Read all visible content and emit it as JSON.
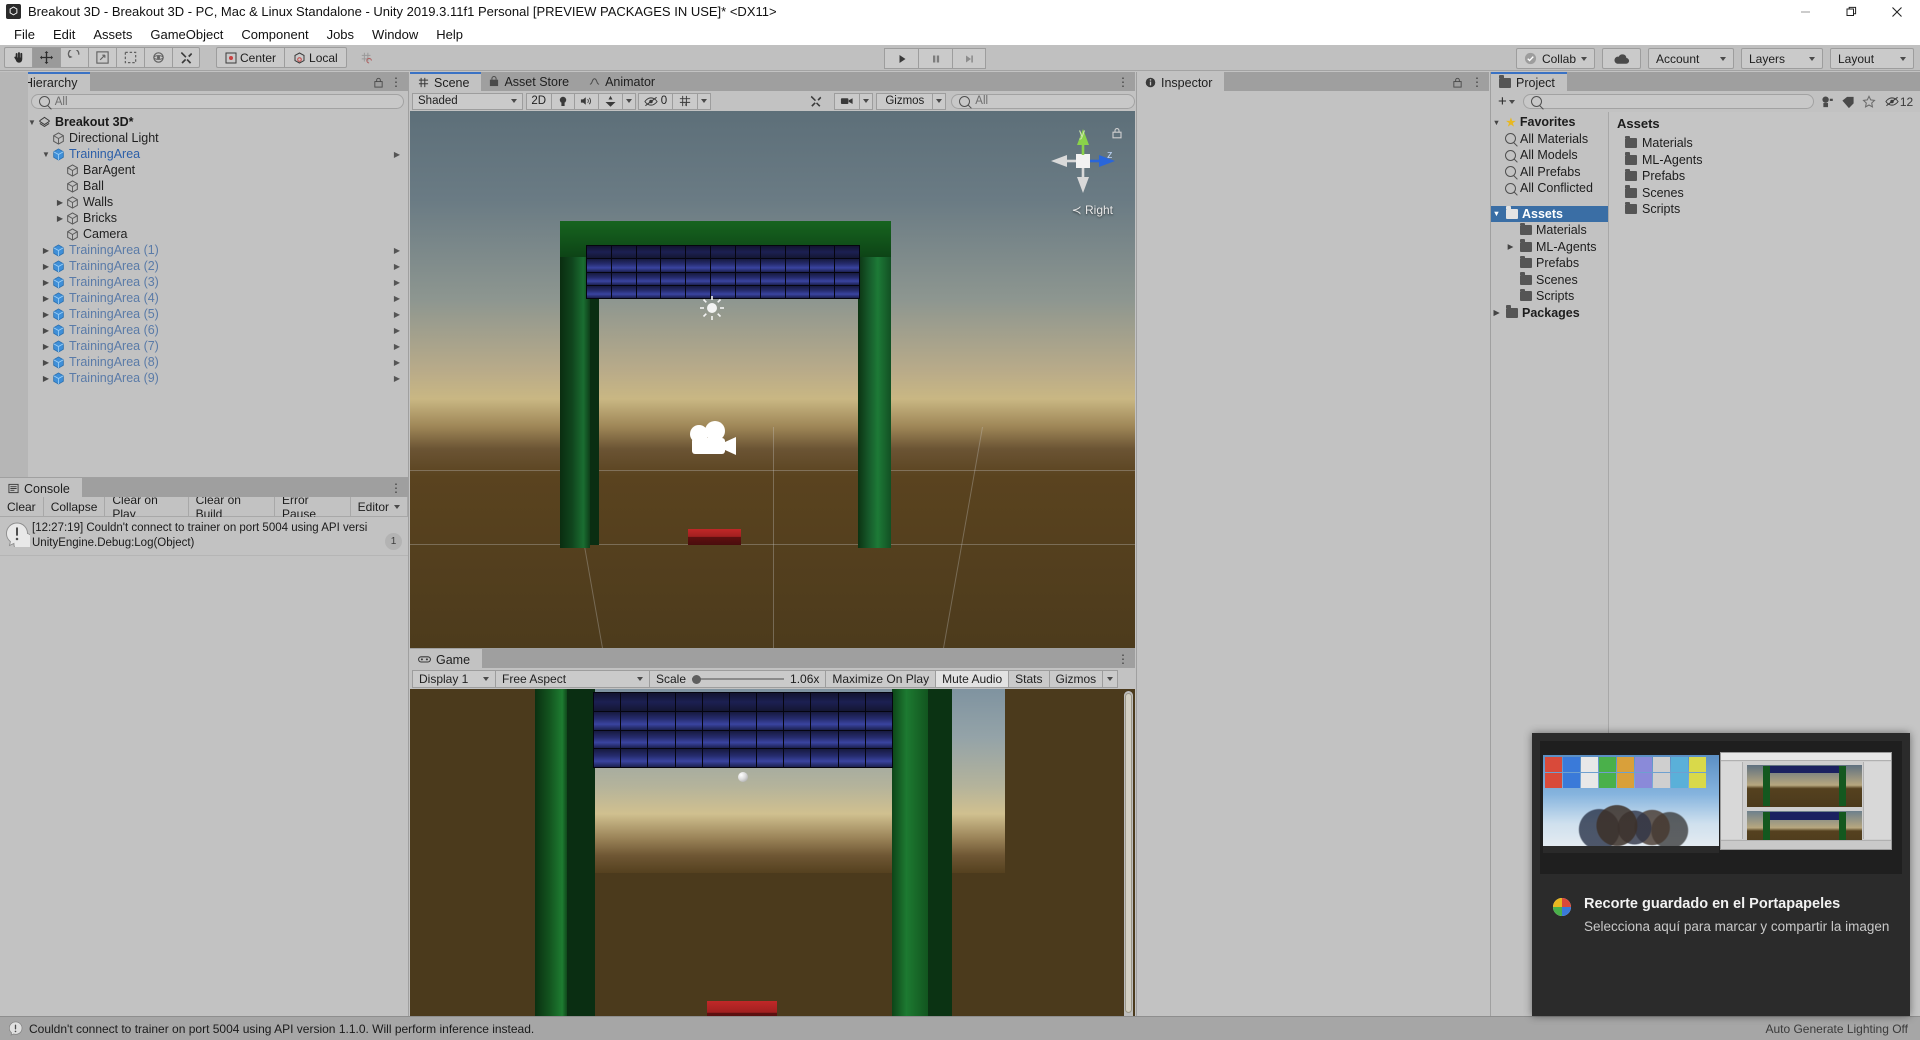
{
  "window": {
    "title": "Breakout 3D - Breakout 3D - PC, Mac & Linux Standalone - Unity 2019.3.11f1 Personal [PREVIEW PACKAGES IN USE]* <DX11>",
    "minimize_label": "Minimize",
    "maximize_label": "Maximize",
    "close_label": "Close"
  },
  "menubar": {
    "items": [
      "File",
      "Edit",
      "Assets",
      "GameObject",
      "Component",
      "Jobs",
      "Window",
      "Help"
    ]
  },
  "toolbar": {
    "tools": [
      "hand-tool",
      "move-tool",
      "rotate-tool",
      "scale-tool",
      "rect-tool",
      "transform-tool",
      "custom-tool"
    ],
    "pivot_mode": "Center",
    "pivot_rotation": "Local",
    "grid_snap": "grid-snap",
    "play": "play-button",
    "pause": "pause-button",
    "step": "step-button",
    "collab": "Collab",
    "cloud": "cloud-button",
    "account": "Account",
    "layers": "Layers",
    "layout": "Layout"
  },
  "hierarchy": {
    "tab": "Hierarchy",
    "create_label": "+",
    "search_placeholder": "All",
    "items": [
      {
        "label": "Breakout 3D*",
        "depth": 0,
        "arrow": "down",
        "icon": "scene-icon",
        "style": "root"
      },
      {
        "label": "Directional Light",
        "depth": 1,
        "arrow": "none",
        "icon": "cube-gray",
        "style": "dark"
      },
      {
        "label": "TrainingArea",
        "depth": 1,
        "arrow": "down",
        "icon": "cube-blue",
        "style": "blue"
      },
      {
        "label": "BarAgent",
        "depth": 2,
        "arrow": "none",
        "icon": "cube-gray",
        "style": "dark"
      },
      {
        "label": "Ball",
        "depth": 2,
        "arrow": "none",
        "icon": "cube-gray",
        "style": "dark"
      },
      {
        "label": "Walls",
        "depth": 2,
        "arrow": "right",
        "icon": "cube-gray",
        "style": "dark"
      },
      {
        "label": "Bricks",
        "depth": 2,
        "arrow": "right",
        "icon": "cube-gray",
        "style": "dark"
      },
      {
        "label": "Camera",
        "depth": 2,
        "arrow": "none",
        "icon": "cube-gray",
        "style": "dark"
      },
      {
        "label": "TrainingArea (1)",
        "depth": 1,
        "arrow": "right",
        "icon": "cube-blue",
        "style": "blue-d"
      },
      {
        "label": "TrainingArea (2)",
        "depth": 1,
        "arrow": "right",
        "icon": "cube-blue",
        "style": "blue-d"
      },
      {
        "label": "TrainingArea (3)",
        "depth": 1,
        "arrow": "right",
        "icon": "cube-blue",
        "style": "blue-d"
      },
      {
        "label": "TrainingArea (4)",
        "depth": 1,
        "arrow": "right",
        "icon": "cube-blue",
        "style": "blue-d"
      },
      {
        "label": "TrainingArea (5)",
        "depth": 1,
        "arrow": "right",
        "icon": "cube-blue",
        "style": "blue-d"
      },
      {
        "label": "TrainingArea (6)",
        "depth": 1,
        "arrow": "right",
        "icon": "cube-blue",
        "style": "blue-d"
      },
      {
        "label": "TrainingArea (7)",
        "depth": 1,
        "arrow": "right",
        "icon": "cube-blue",
        "style": "blue-d"
      },
      {
        "label": "TrainingArea (8)",
        "depth": 1,
        "arrow": "right",
        "icon": "cube-blue",
        "style": "blue-d"
      },
      {
        "label": "TrainingArea (9)",
        "depth": 1,
        "arrow": "right",
        "icon": "cube-blue",
        "style": "blue-d"
      }
    ]
  },
  "console": {
    "tab": "Console",
    "buttons": [
      "Clear",
      "Collapse",
      "Clear on Play",
      "Clear on Build",
      "Error Pause"
    ],
    "editor_dropdown": "Editor",
    "entry": {
      "line1": "[12:27:19] Couldn't connect to trainer on port 5004 using API versi",
      "line2": "UnityEngine.Debug:Log(Object)",
      "count": "1",
      "icon": "warning-icon"
    }
  },
  "scene": {
    "tabs": [
      {
        "label": "Scene",
        "icon": "grid-icon",
        "selected": true
      },
      {
        "label": "Asset Store",
        "icon": "store-icon",
        "selected": false
      },
      {
        "label": "Animator",
        "icon": "animator-icon",
        "selected": false
      }
    ],
    "draw_mode": "Shaded",
    "mode_2d": "2D",
    "lighting_toggle": "lighting-icon",
    "audio_toggle": "audio-icon",
    "fx_toggle": "fx-icon",
    "hidden_count": "0",
    "grid_toggle": "grid-visibility-icon",
    "component_tools": "component-tools-icon",
    "camera_settings": "camera-icon",
    "gizmos": "Gizmos",
    "search_placeholder": "All",
    "view_label": "Right",
    "axis_labels": {
      "y": "y",
      "z": "z"
    }
  },
  "game": {
    "tab": "Game",
    "display": "Display 1",
    "aspect": "Free Aspect",
    "scale_label": "Scale",
    "scale_value": "1.06x",
    "maximize": "Maximize On Play",
    "mute": "Mute Audio",
    "stats": "Stats",
    "gizmos": "Gizmos"
  },
  "inspector": {
    "tab": "Inspector",
    "lock": "lock-icon",
    "options": "options-icon"
  },
  "project": {
    "tab": "Project",
    "create_label": "+",
    "search_placeholder": "",
    "icon_count": "12",
    "favorites_label": "Favorites",
    "favorites": [
      "All Materials",
      "All Models",
      "All Prefabs",
      "All Conflicted"
    ],
    "tree": [
      {
        "label": "Assets",
        "arrow": "down",
        "depth": 0,
        "selected": true,
        "bold": true
      },
      {
        "label": "Materials",
        "arrow": "none",
        "depth": 1,
        "selected": false,
        "bold": false
      },
      {
        "label": "ML-Agents",
        "arrow": "right",
        "depth": 1,
        "selected": false,
        "bold": false
      },
      {
        "label": "Prefabs",
        "arrow": "none",
        "depth": 1,
        "selected": false,
        "bold": false
      },
      {
        "label": "Scenes",
        "arrow": "none",
        "depth": 1,
        "selected": false,
        "bold": false
      },
      {
        "label": "Scripts",
        "arrow": "none",
        "depth": 1,
        "selected": false,
        "bold": false
      },
      {
        "label": "Packages",
        "arrow": "right",
        "depth": 0,
        "selected": false,
        "bold": true
      }
    ],
    "content_title": "Assets",
    "content_items": [
      "Materials",
      "ML-Agents",
      "Prefabs",
      "Scenes",
      "Scripts"
    ]
  },
  "statusbar": {
    "icon": "warning-icon",
    "message": "Couldn't connect to trainer on port 5004 using API version 1.1.0. Will perform inference instead.",
    "right_message": "Auto Generate Lighting Off"
  },
  "toast": {
    "app_icon": "snip-sketch-icon",
    "title": "Recorte guardado en el Portapapeles",
    "subtitle": "Selecciona aquí para marcar y compartir la imagen"
  },
  "colors": {
    "accent_blue": "#3a6ea5",
    "tab_highlight": "#3a72c4",
    "pillar_green": "#1a6e31",
    "brick_blue": "#2a3180",
    "paddle_red": "#b62525",
    "ground_brown": "#4b3a1c",
    "panel_bg": "#c2c2c2"
  }
}
